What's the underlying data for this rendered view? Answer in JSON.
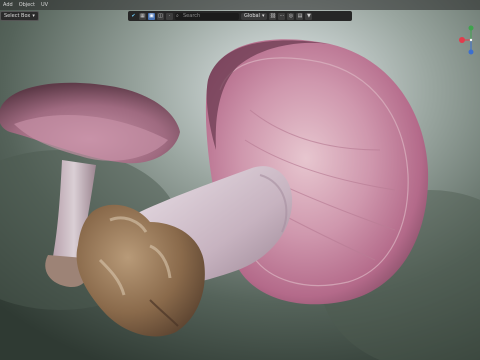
{
  "menubar": {
    "items": [
      "Add",
      "Object",
      "UV"
    ]
  },
  "select_mode": {
    "label": "Select Box",
    "arrow": "chevron-down-icon"
  },
  "header": {
    "orientation": {
      "label": "Global"
    },
    "search": {
      "placeholder": "Search"
    },
    "buttons": [
      "check-icon",
      "grid-icon",
      "select-icon",
      "toggle-icon",
      "tool-a",
      "tool-b",
      "tool-c",
      "link-icon",
      "proportional-icon",
      "filter-icon"
    ]
  },
  "gizmo": {
    "x_color": "#e33b4c",
    "y_color": "#3fa34d",
    "z_color": "#3b6fd0"
  },
  "scene": {
    "background": "#3d4a42",
    "cap_color_large": "#b45f86",
    "cap_color_small": "#8e5a6e",
    "stem_color": "#c9b4c2"
  }
}
